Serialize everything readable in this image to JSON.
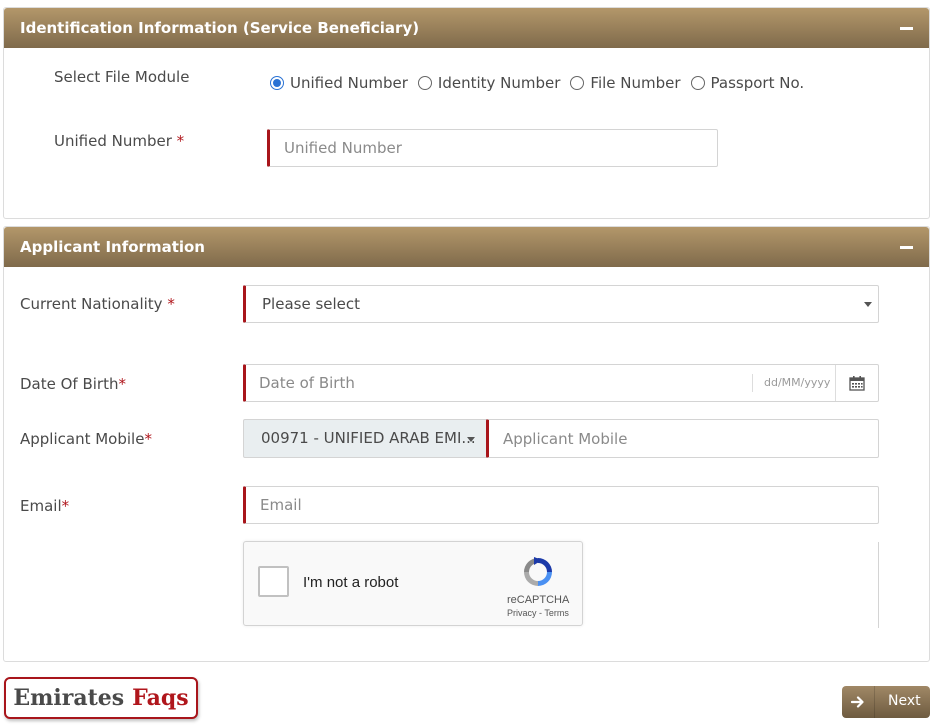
{
  "identification": {
    "title": "Identification Information (Service Beneficiary)",
    "file_module_label": "Select File Module",
    "options": [
      "Unified Number",
      "Identity Number",
      "File Number",
      "Passport No."
    ],
    "selected": "Unified Number",
    "unified_label": "Unified Number",
    "unified_placeholder": "Unified Number"
  },
  "applicant": {
    "title": "Applicant Information",
    "nationality_label": "Current Nationality",
    "nationality_value": "Please select",
    "dob_label": "Date Of Birth",
    "dob_placeholder": "Date of Birth",
    "dob_format": "dd/MM/yyyy",
    "mobile_label": "Applicant Mobile",
    "country_code": "00971 - UNIFIED ARAB EMI...",
    "mobile_placeholder": "Applicant Mobile",
    "email_label": "Email",
    "email_placeholder": "Email"
  },
  "recaptcha": {
    "label": "I'm not a robot",
    "brand": "reCAPTCHA",
    "privacy": "Privacy",
    "separator": " - ",
    "terms": "Terms"
  },
  "watermark": {
    "word1": "Emirates",
    "word2": "Faqs"
  },
  "next_label": "Next",
  "required_mark": "*",
  "colors": {
    "header_top": "#b3976a",
    "header_bottom": "#7f6a4b",
    "required": "#b0161c",
    "radio_selected": "#2a72d4"
  }
}
